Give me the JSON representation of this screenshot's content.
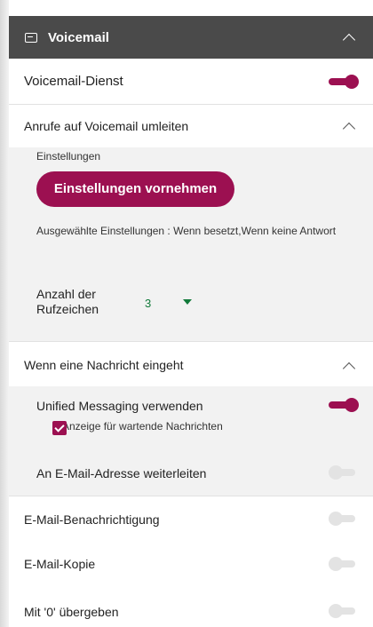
{
  "header": {
    "title": "Voicemail",
    "icon": "voicemail-icon"
  },
  "voicemail_service": {
    "label": "Voicemail-Dienst",
    "enabled": true
  },
  "forward_calls": {
    "label": "Anrufe auf Voicemail umleiten",
    "settings_heading": "Einstellungen",
    "settings_button": "Einstellungen vornehmen",
    "selected_settings": "Ausgewählte Einstellungen : Wenn besetzt,Wenn keine Antwort",
    "ring_count_label": "Anzahl der Rufzeichen",
    "ring_count_value": "3"
  },
  "on_message": {
    "label": "Wenn eine Nachricht eingeht",
    "unified_messaging": {
      "label": "Unified Messaging verwenden",
      "enabled": true
    },
    "waiting_indicator": {
      "label": "Anzeige für wartende Nachrichten",
      "checked": true
    },
    "forward_email": {
      "label": "An E-Mail-Adresse weiterleiten",
      "enabled": false
    }
  },
  "email_notification": {
    "label": "E-Mail-Benachrichtigung",
    "enabled": false
  },
  "email_copy": {
    "label": "E-Mail-Kopie",
    "enabled": false
  },
  "pass_zero": {
    "label": "Mit '0' übergeben",
    "enabled": false
  },
  "colors": {
    "accent": "#9c1051",
    "header_bg": "#4a4a4a",
    "section_bg": "#f2f2f2",
    "ring_value": "#127a3a"
  }
}
